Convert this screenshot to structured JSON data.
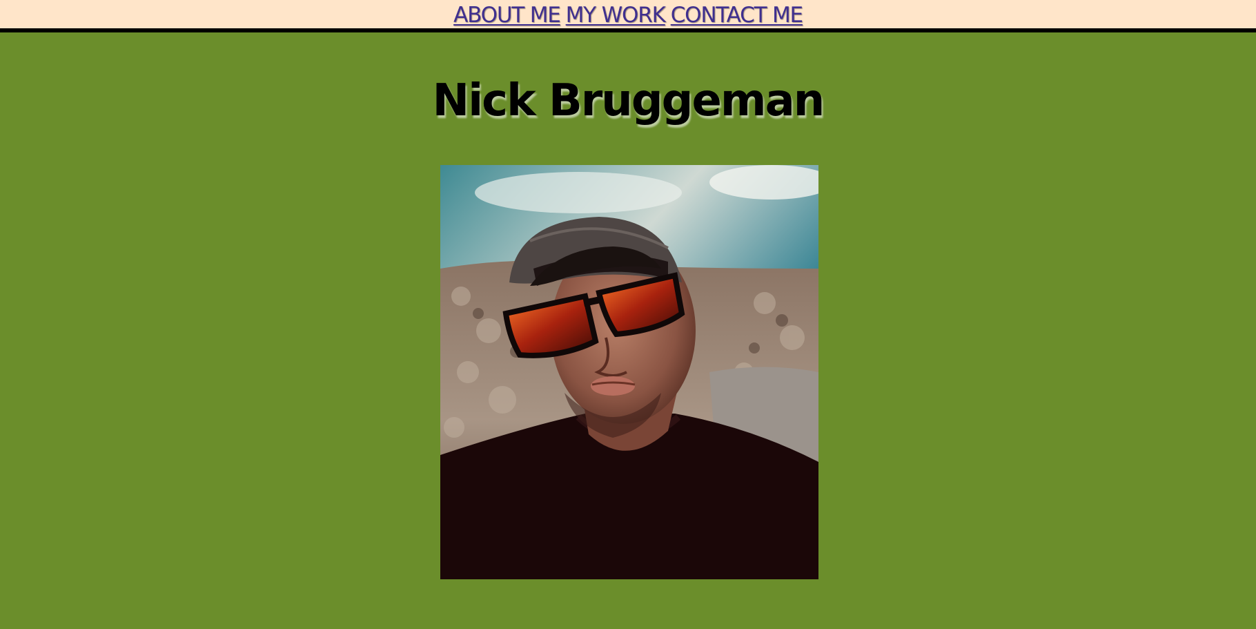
{
  "nav": {
    "about": "ABOUT ME",
    "work": "MY WORK",
    "contact": "CONTACT ME"
  },
  "header": {
    "title": "Nick Bruggeman"
  },
  "photo": {
    "alt": "Nick Bruggeman"
  },
  "colors": {
    "page_background": "#6b8e2b",
    "nav_background": "#ffe5c9",
    "link": "#3f2f8f",
    "nav_border": "#000000"
  }
}
